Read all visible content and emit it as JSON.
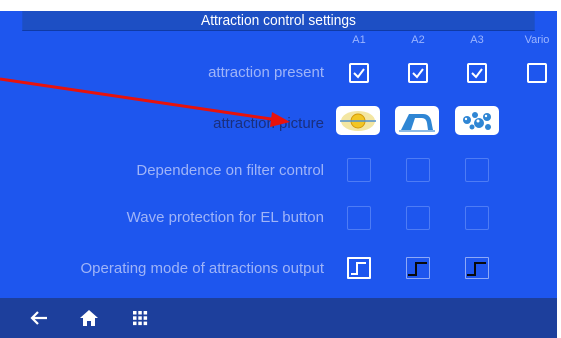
{
  "title": "Attraction control settings",
  "columns": [
    "A1",
    "A2",
    "A3",
    "Vario"
  ],
  "rows": [
    {
      "label": "attraction present",
      "type": "checkbox",
      "values": [
        true,
        true,
        true,
        false
      ],
      "enabled": [
        true,
        true,
        true,
        true
      ]
    },
    {
      "label": "attraction picture",
      "type": "picture",
      "icons": [
        "lamp-light-icon",
        "water-fall-icon",
        "air-bubbles-icon"
      ]
    },
    {
      "label": "Dependence on filter control",
      "type": "checkbox",
      "values": [
        false,
        false,
        false
      ],
      "enabled": [
        false,
        false,
        false
      ]
    },
    {
      "label": "Wave protection for EL button",
      "type": "checkbox",
      "values": [
        false,
        false,
        false
      ],
      "enabled": [
        false,
        false,
        false
      ]
    },
    {
      "label": "Operating mode of attractions output",
      "type": "mode",
      "active": [
        true,
        false,
        false
      ],
      "icon": "pulse-step-icon"
    }
  ],
  "nav": [
    {
      "name": "back-icon"
    },
    {
      "name": "home-icon"
    },
    {
      "name": "grid-menu-icon"
    }
  ],
  "colors": {
    "background": "#1e56ee",
    "titlebar": "#1d4fc4",
    "bottombar": "#1d3f9c",
    "annotation_arrow": "#e8120c"
  }
}
